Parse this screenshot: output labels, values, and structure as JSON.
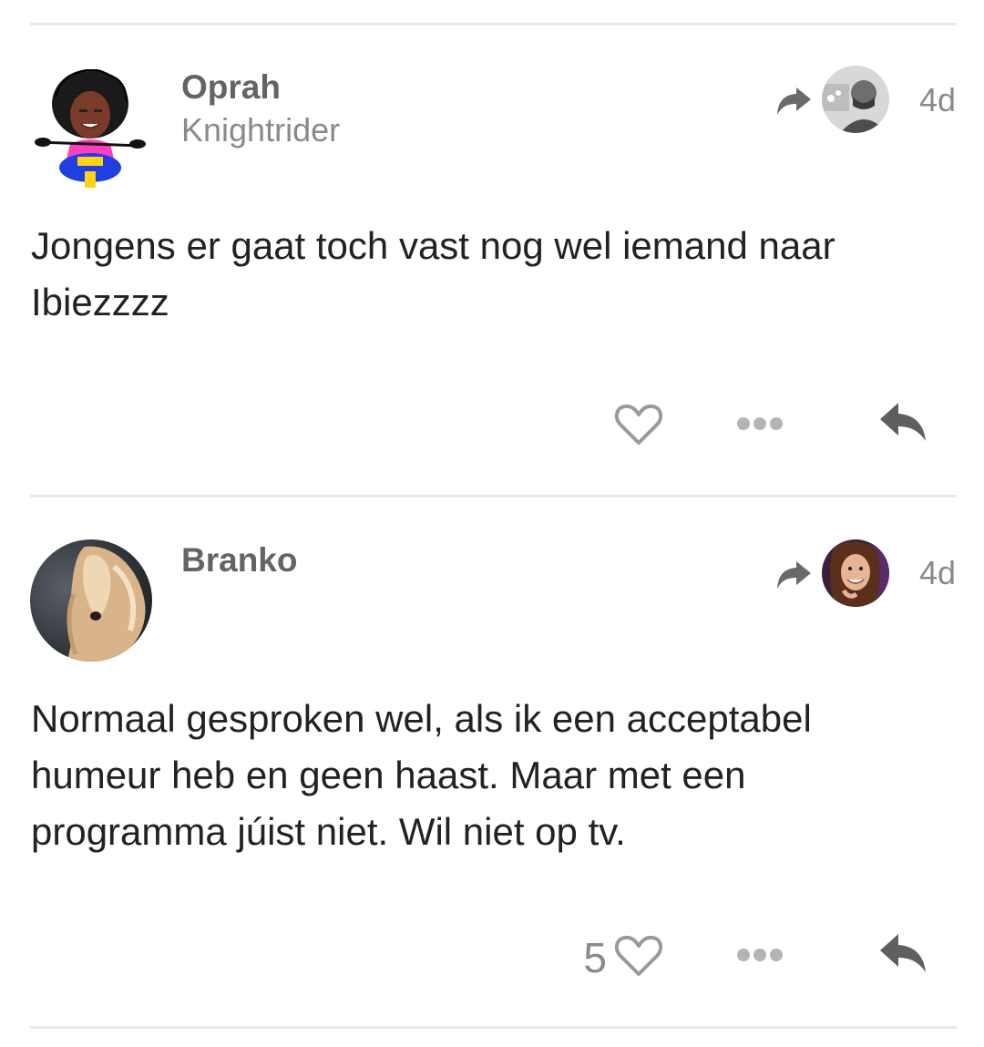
{
  "posts": [
    {
      "username": "Oprah",
      "user_title": "Knightrider",
      "avatar_icon": "avatar-cartoon-woman-on-scooter",
      "reply_to_avatar_icon": "avatar-bearded-man",
      "date": "4d",
      "body": "Jongens er gaat toch vast nog wel iemand naar Ibiezzzz",
      "like_count": "",
      "icons": [
        "share-arrow-icon",
        "heart-icon",
        "more-icon",
        "reply-icon"
      ]
    },
    {
      "username": "Branko",
      "user_title": "",
      "avatar_icon": "avatar-afghan-hound",
      "reply_to_avatar_icon": "avatar-smiling-woman",
      "date": "4d",
      "body": "Normaal gesproken wel, als ik een acceptabel humeur heb en geen haast. Maar met een programma júist niet. Wil niet op tv.",
      "like_count": "5",
      "icons": [
        "share-arrow-icon",
        "heart-icon",
        "more-icon",
        "reply-icon"
      ]
    }
  ],
  "colors": {
    "text": "#222222",
    "muted": "#8a8a8a",
    "username": "#646464",
    "divider": "#e9e9e9",
    "icon": "#5f5f5f"
  }
}
